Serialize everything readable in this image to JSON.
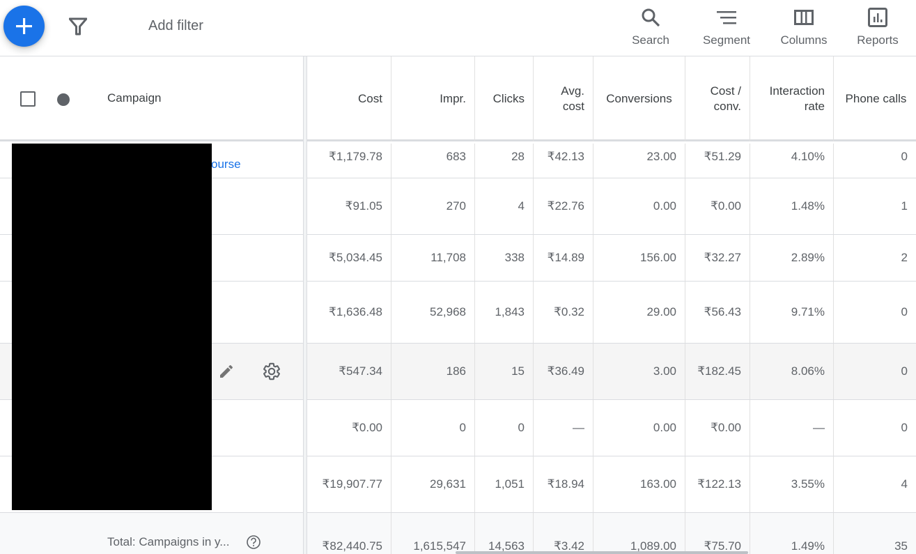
{
  "toolbar": {
    "add_filter": "Add filter",
    "buttons": [
      {
        "label": "Search",
        "icon": "search-icon"
      },
      {
        "label": "Segment",
        "icon": "segment-icon"
      },
      {
        "label": "Columns",
        "icon": "columns-icon"
      },
      {
        "label": "Reports",
        "icon": "reports-icon"
      }
    ],
    "accent": "#1a73e8"
  },
  "table": {
    "columns": {
      "campaign": "Campaign",
      "cost": "Cost",
      "impr": "Impr.",
      "clicks": "Clicks",
      "avg_cost_1": "Avg.",
      "avg_cost_2": "cost",
      "conversions": "Conversions",
      "cost_conv_1": "Cost /",
      "cost_conv_2": "conv.",
      "interaction_1": "Interaction",
      "interaction_2": "rate",
      "phone_calls": "Phone calls"
    },
    "rows": [
      {
        "campaign_visible": "ourse",
        "cost": "₹1,179.78",
        "impr": "683",
        "clicks": "28",
        "avg_cost": "₹42.13",
        "conversions": "23.00",
        "cost_conv": "₹51.29",
        "interaction_rate": "4.10%",
        "phone_calls": "0"
      },
      {
        "campaign_visible": "",
        "cost": "₹91.05",
        "impr": "270",
        "clicks": "4",
        "avg_cost": "₹22.76",
        "conversions": "0.00",
        "cost_conv": "₹0.00",
        "interaction_rate": "1.48%",
        "phone_calls": "1"
      },
      {
        "campaign_visible": "",
        "cost": "₹5,034.45",
        "impr": "11,708",
        "clicks": "338",
        "avg_cost": "₹14.89",
        "conversions": "156.00",
        "cost_conv": "₹32.27",
        "interaction_rate": "2.89%",
        "phone_calls": "2"
      },
      {
        "campaign_visible": "",
        "cost": "₹1,636.48",
        "impr": "52,968",
        "clicks": "1,843",
        "avg_cost": "₹0.32",
        "conversions": "29.00",
        "cost_conv": "₹56.43",
        "interaction_rate": "9.71%",
        "phone_calls": "0"
      },
      {
        "campaign_visible": "",
        "cost": "₹547.34",
        "impr": "186",
        "clicks": "15",
        "avg_cost": "₹36.49",
        "conversions": "3.00",
        "cost_conv": "₹182.45",
        "interaction_rate": "8.06%",
        "phone_calls": "0"
      },
      {
        "campaign_visible": "",
        "cost": "₹0.00",
        "impr": "0",
        "clicks": "0",
        "avg_cost": "—",
        "conversions": "0.00",
        "cost_conv": "₹0.00",
        "interaction_rate": "—",
        "phone_calls": "0"
      },
      {
        "campaign_visible": "",
        "cost": "₹19,907.77",
        "impr": "29,631",
        "clicks": "1,051",
        "avg_cost": "₹18.94",
        "conversions": "163.00",
        "cost_conv": "₹122.13",
        "interaction_rate": "3.55%",
        "phone_calls": "4"
      }
    ],
    "total": {
      "label": "Total: Campaigns in y...",
      "cost": "₹82,440.75",
      "impr": "1,615,547",
      "clicks": "14,563",
      "avg_cost": "₹3.42",
      "conversions": "1,089.00",
      "cost_conv": "₹75.70",
      "interaction_rate": "1.49%",
      "phone_calls": "35"
    }
  }
}
